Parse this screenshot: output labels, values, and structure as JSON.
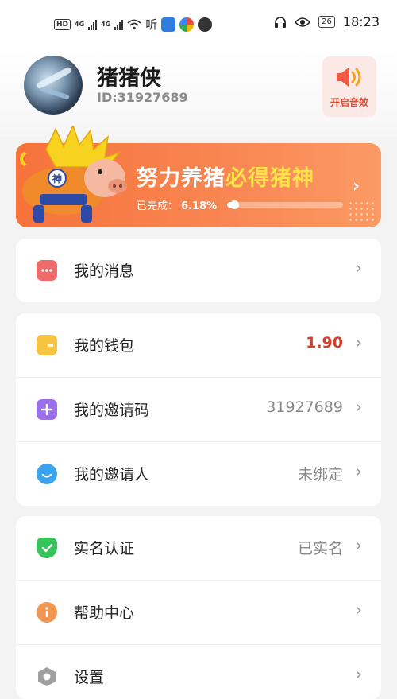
{
  "status_bar": {
    "time": "18:23",
    "battery": "26",
    "hd_label": "HD",
    "net_label_1": "4G",
    "net_label_2": "4G",
    "extra_label": "听"
  },
  "profile": {
    "username": "猪猪侠",
    "user_id": "ID:31927689",
    "sound_button_label": "开启音效"
  },
  "banner": {
    "title_prefix": "努力养猪",
    "title_highlight": "必得猪神",
    "progress_label": "已完成：",
    "progress_value": "6.18%",
    "progress_fraction": 0.0618
  },
  "menu_groups": [
    {
      "items": [
        {
          "label": "我的消息",
          "value": "",
          "icon": "message-icon",
          "color": "#ef6b6b"
        }
      ]
    },
    {
      "items": [
        {
          "label": "我的钱包",
          "value": "1.90",
          "icon": "wallet-icon",
          "color": "#f6c440"
        },
        {
          "label": "我的邀请码",
          "value": "31927689",
          "icon": "invite-code-icon",
          "color": "#9c70ea"
        },
        {
          "label": "我的邀请人",
          "value": "未绑定",
          "icon": "inviter-icon",
          "color": "#3aa3f0"
        }
      ]
    },
    {
      "items": [
        {
          "label": "实名认证",
          "value": "已实名",
          "icon": "verified-icon",
          "color": "#37c45a"
        },
        {
          "label": "帮助中心",
          "value": "",
          "icon": "help-info-icon",
          "color": "#f29752"
        },
        {
          "label": "设置",
          "value": "",
          "icon": "settings-icon",
          "color": "#9a9a9a"
        }
      ]
    }
  ],
  "colors": {
    "accent_orange": "#f6733b",
    "highlight_yellow": "#ffe14a",
    "value_red": "#d4402c"
  }
}
